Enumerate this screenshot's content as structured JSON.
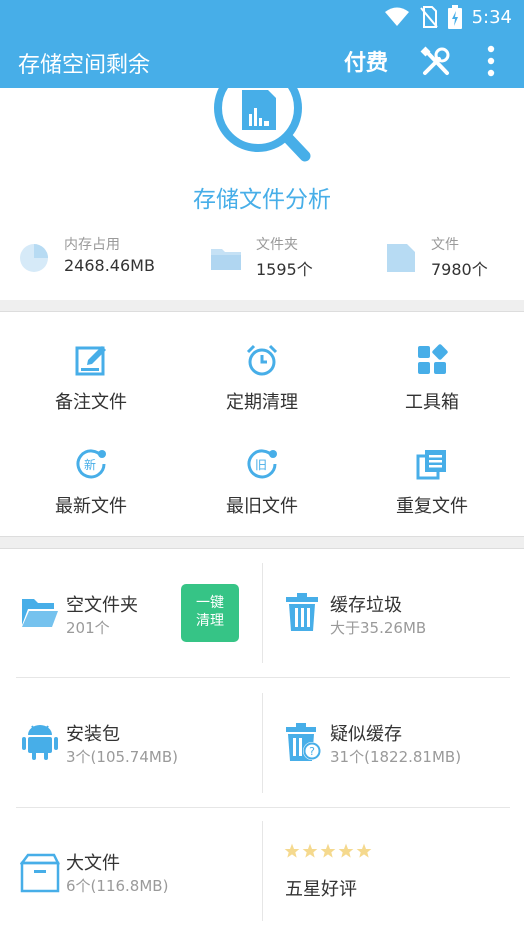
{
  "status": {
    "time": "5:34"
  },
  "appbar": {
    "title": "存储空间剩余",
    "pay_label": "付费"
  },
  "hero": {
    "title": "存储文件分析"
  },
  "stats": [
    {
      "label": "内存占用",
      "value": "2468.46MB",
      "icon": "pie-chart-icon"
    },
    {
      "label": "文件夹",
      "value": "1595个",
      "icon": "folder-icon"
    },
    {
      "label": "文件",
      "value": "7980个",
      "icon": "file-icon"
    }
  ],
  "grid": [
    {
      "label": "备注文件",
      "icon": "edit-icon"
    },
    {
      "label": "定期清理",
      "icon": "alarm-clock-icon"
    },
    {
      "label": "工具箱",
      "icon": "toolbox-icon"
    },
    {
      "label": "最新文件",
      "icon": "newest-icon",
      "badge": "新"
    },
    {
      "label": "最旧文件",
      "icon": "oldest-icon",
      "badge": "旧"
    },
    {
      "label": "重复文件",
      "icon": "duplicate-icon"
    }
  ],
  "cards": {
    "empty_folder": {
      "title": "空文件夹",
      "sub": "201个",
      "button_line1": "一键",
      "button_line2": "清理"
    },
    "cache_junk": {
      "title": "缓存垃圾",
      "sub": "大于35.26MB"
    },
    "apk": {
      "title": "安装包",
      "sub": "3个(105.74MB)"
    },
    "suspect_cache": {
      "title": "疑似缓存",
      "sub": "31个(1822.81MB)"
    },
    "big_file": {
      "title": "大文件",
      "sub": "6个(116.8MB)"
    },
    "rating": {
      "title": "五星好评",
      "stars": 5
    }
  },
  "colors": {
    "primary": "#47aee8",
    "accent_green": "#36c486",
    "star": "#f5d98e"
  }
}
